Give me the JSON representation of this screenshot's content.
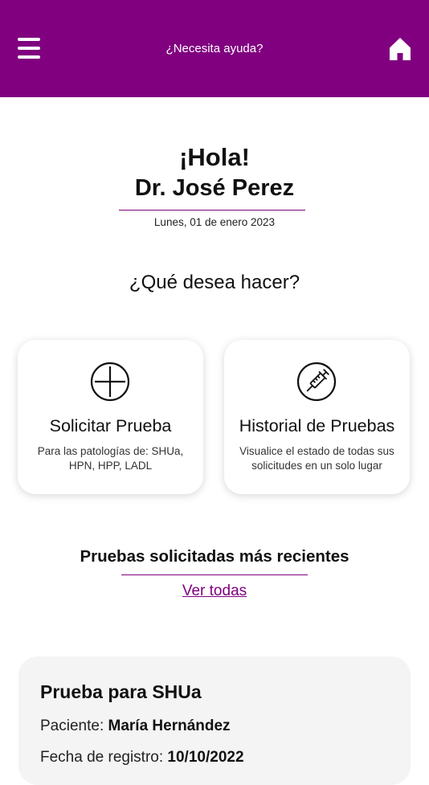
{
  "header": {
    "menu_icon": "hamburger-menu-icon",
    "help_label": "¿Necesita ayuda?",
    "home_icon": "home-icon",
    "background_color": "#80007f"
  },
  "welcome": {
    "greeting": "¡Hola!",
    "doctor_name": "Dr. José Perez",
    "date": "Lunes, 01 de enero 2023"
  },
  "question": "¿Qué desea hacer?",
  "actions": [
    {
      "icon": "plus-circle-icon",
      "title": "Solicitar Prueba",
      "description": "Para las patologías de: SHUa, HPN, HPP, LADL"
    },
    {
      "icon": "syringe-icon",
      "title": "Historial de Pruebas",
      "description": "Visualice el estado de todas sus solicitudes en un solo lugar"
    }
  ],
  "recent": {
    "title": "Pruebas solicitadas más recientes",
    "see_all_label": "Ver todas"
  },
  "tests": [
    {
      "title": "Prueba para SHUa",
      "patient_label": "Paciente:",
      "patient_name": "María Hernández",
      "date_label": "Fecha de registro:",
      "date_value": "10/10/2022"
    }
  ],
  "accent_color": "#80007f"
}
